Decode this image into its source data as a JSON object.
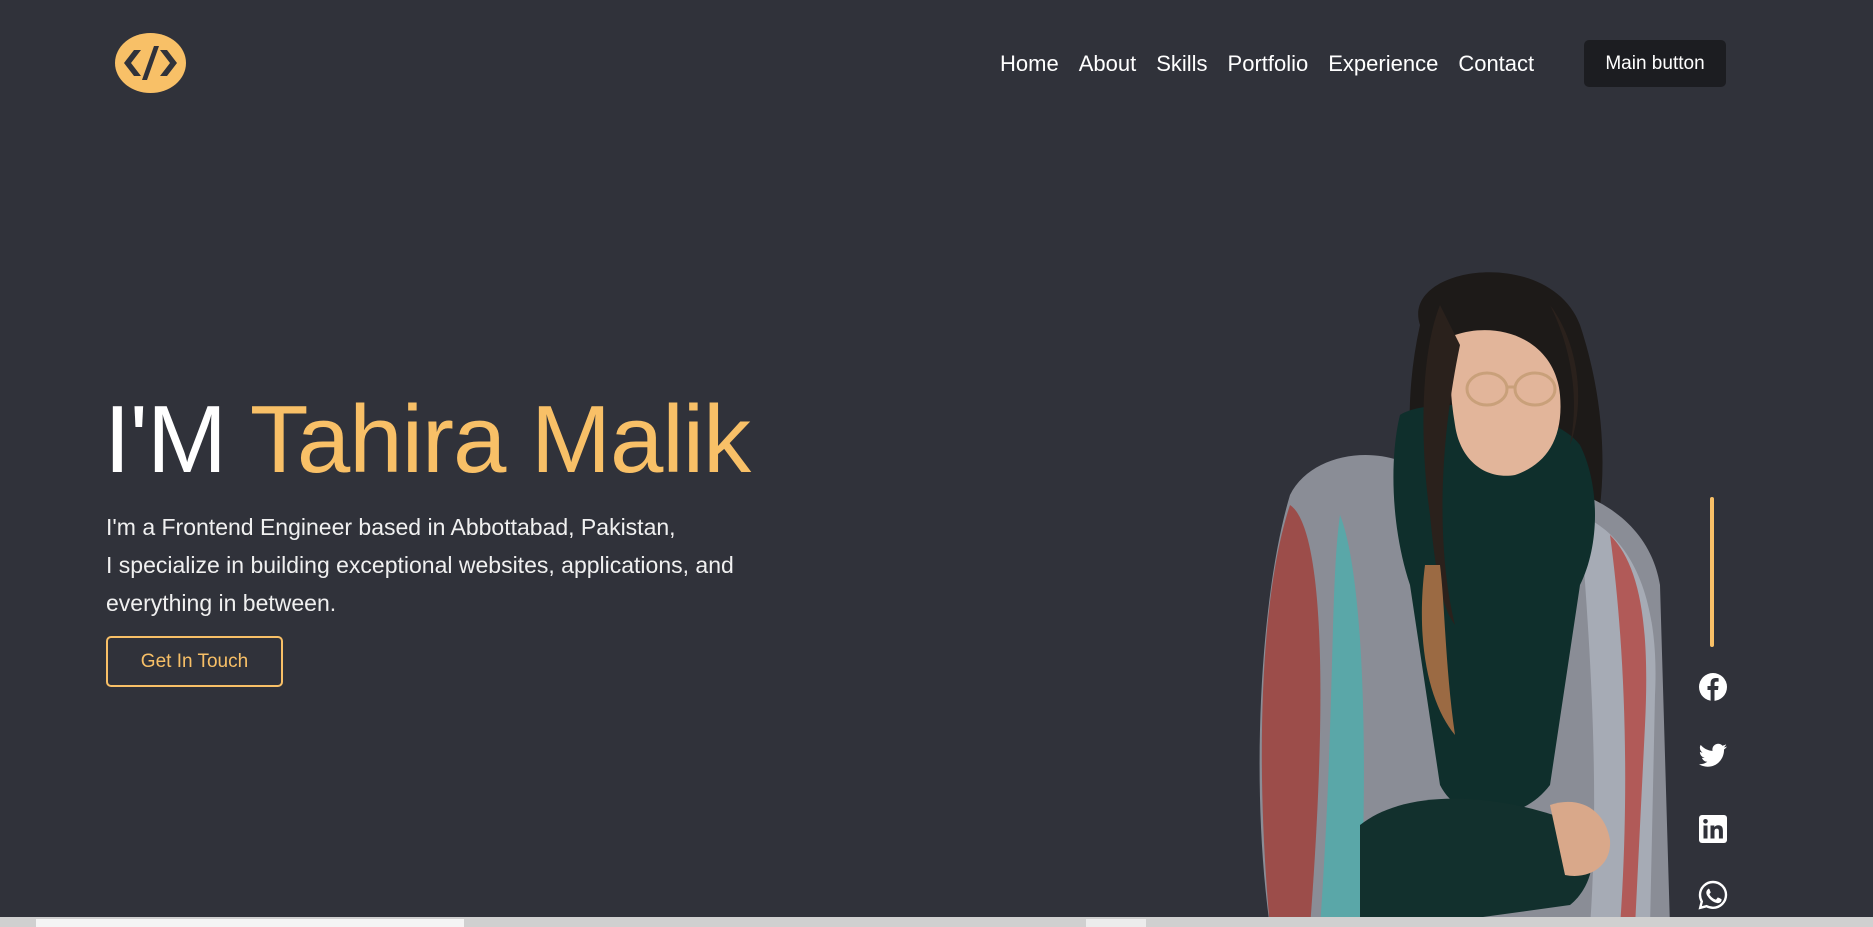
{
  "header": {
    "logo_icon": "code-brackets-icon",
    "nav": [
      "Home",
      "About",
      "Skills",
      "Portfolio",
      "Experience",
      "Contact"
    ],
    "main_button": "Main button"
  },
  "hero": {
    "title_prefix": "I'M",
    "title_name": "Tahira Malik",
    "description_lines": [
      "I'm a Frontend Engineer based in Abbottabad, Pakistan,",
      "I specialize in building exceptional websites, applications, and",
      "everything in between."
    ],
    "cta_label": "Get In Touch"
  },
  "social_icons": [
    "facebook-icon",
    "twitter-icon",
    "linkedin-icon",
    "whatsapp-icon"
  ],
  "colors": {
    "background": "#30323a",
    "accent": "#f8c067",
    "text": "#ffffff",
    "button_dark": "#1c1d21"
  }
}
